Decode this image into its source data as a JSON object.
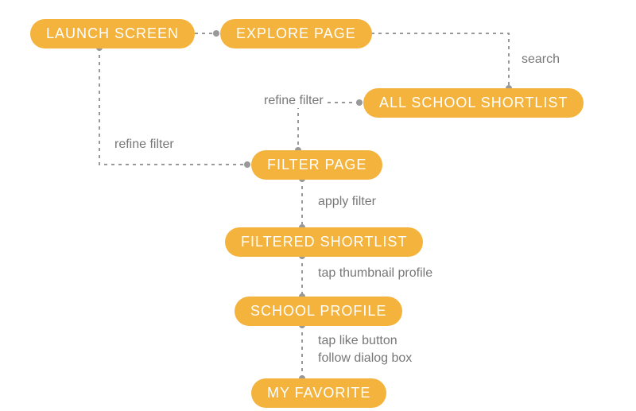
{
  "nodes": {
    "launch_screen": "LAUNCH SCREEN",
    "explore_page": "EXPLORE PAGE",
    "all_school_shortlist": "ALL SCHOOL SHORTLIST",
    "filter_page": "FILTER PAGE",
    "filtered_shortlist": "FILTERED SHORTLIST",
    "school_profile": "SCHOOL PROFILE",
    "my_favorite": "MY FAVORITE"
  },
  "edges": {
    "search": "search",
    "refine_filter_top": "refine filter",
    "refine_filter_left": "refine filter",
    "apply_filter": "apply filter",
    "tap_thumbnail": "tap thumbnail profile",
    "tap_like_1": "tap like button",
    "tap_like_2": "follow dialog box"
  },
  "colors": {
    "node_bg": "#f3b33d",
    "node_text": "#ffffff",
    "edge_text": "#777777",
    "connector": "#999999"
  }
}
